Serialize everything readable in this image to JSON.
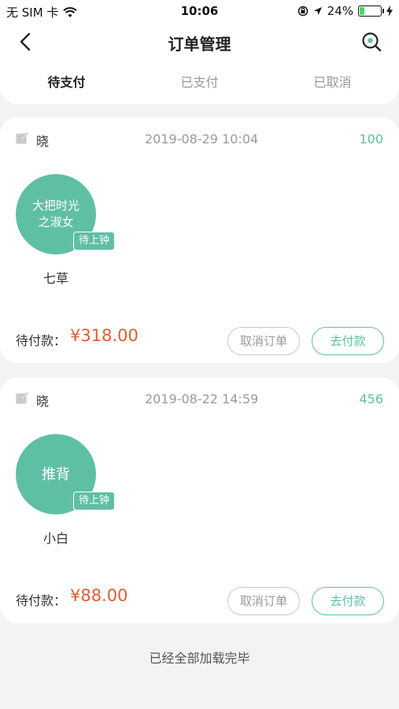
{
  "status_bar": {
    "carrier": "无 SIM 卡",
    "time": "10:06",
    "battery_text": "24%",
    "battery_level": 0.24
  },
  "header": {
    "title": "订单管理",
    "icons": {
      "back": "back-chevron-icon",
      "search": "search-icon"
    }
  },
  "tabs": [
    {
      "label": "待支付",
      "active": true
    },
    {
      "label": "已支付",
      "active": false
    },
    {
      "label": "已取消",
      "active": false
    }
  ],
  "orders": [
    {
      "customer": "晓",
      "date": "2019-08-29 10:04",
      "order_no": "100",
      "service": "大把时光之淑女",
      "status_badge": "待上钟",
      "technician": "七草",
      "pay_label": "待付款：",
      "amount": "¥318.00",
      "cancel_label": "取消订单",
      "pay_button": "去付款"
    },
    {
      "customer": "晓",
      "date": "2019-08-22 14:59",
      "order_no": "456",
      "service": "推背",
      "status_badge": "待上钟",
      "technician": "小白",
      "pay_label": "待付款：",
      "amount": "¥88.00",
      "cancel_label": "取消订单",
      "pay_button": "去付款"
    }
  ],
  "footer_text": "已经全部加载完毕",
  "colors": {
    "accent": "#5fbfa4",
    "price": "#e05d35",
    "background": "#f3f3f3"
  }
}
